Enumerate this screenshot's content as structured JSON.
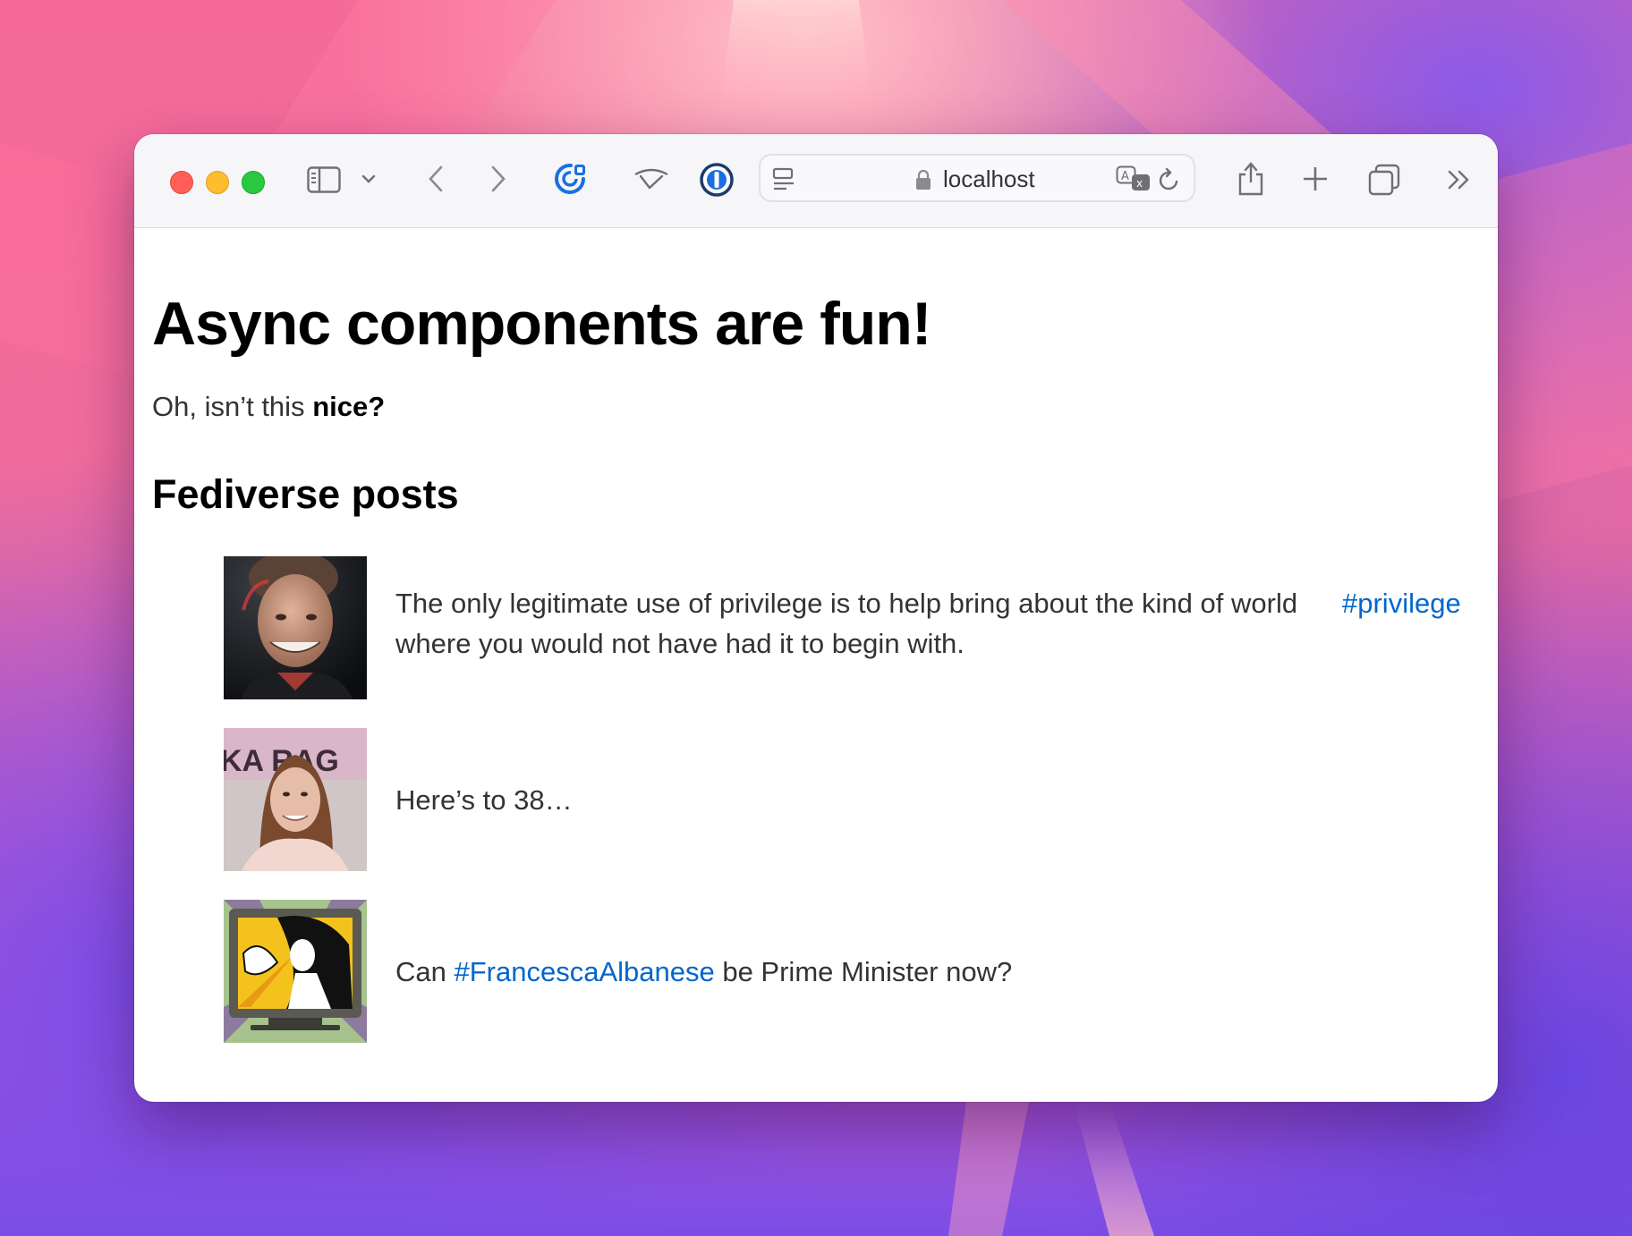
{
  "browser": {
    "address": "localhost",
    "icons": [
      "close-light",
      "minimize-light",
      "zoom-light",
      "sidebar-icon",
      "chevron-down-icon",
      "back-icon",
      "forward-icon",
      "extension-icon",
      "wiper-icon",
      "password-manager-icon",
      "reader-icon",
      "lock-icon",
      "translate-icon",
      "reload-icon",
      "share-icon",
      "new-tab-icon",
      "tab-overview-icon",
      "more-icon"
    ]
  },
  "page": {
    "title": "Async components are fun!",
    "intro_prefix": "Oh, isn’t this ",
    "intro_bold": "nice?",
    "section_heading": "Fediverse posts"
  },
  "posts": [
    {
      "text": "The only legitimate use of privilege is to help bring about the kind of world where you would not have had it to begin with.",
      "hashtag": "#privilege"
    },
    {
      "text": "Here’s to 38…"
    },
    {
      "text_before": "Can ",
      "hashtag": "#FrancescaAlbanese",
      "text_after": " be Prime Minister now?",
      "avatar_text": "KA RAG"
    }
  ],
  "colors": {
    "link": "#0066cc",
    "close": "#ff5f57",
    "minimize": "#febc2e",
    "zoom": "#28c840",
    "accent_icon": "#1a6fe0"
  }
}
